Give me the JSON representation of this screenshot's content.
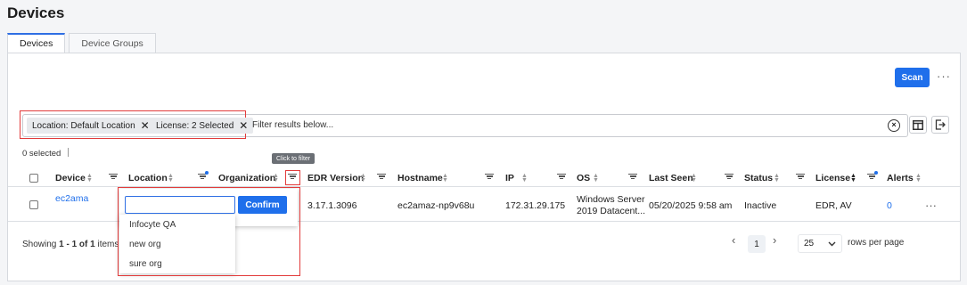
{
  "page_title": "Devices",
  "tabs": [
    {
      "label": "Devices",
      "active": true
    },
    {
      "label": "Device Groups",
      "active": false
    }
  ],
  "toolbar": {
    "scan_label": "Scan",
    "more_label": "···"
  },
  "filters": {
    "chips": [
      {
        "label": "Location:  Default Location"
      },
      {
        "label": "License:  2 Selected"
      }
    ],
    "placeholder": "Filter results below...",
    "chip_close": "✕"
  },
  "selection": {
    "text": "0 selected"
  },
  "tooltip": "Click to filter",
  "columns": [
    "Device",
    "Location",
    "Organization",
    "EDR Version",
    "Hostname",
    "IP",
    "OS",
    "Last Seen",
    "Status",
    "License",
    "Alerts"
  ],
  "rows": [
    {
      "device": "ec2ama",
      "edr_version": "3.17.1.3096",
      "hostname": "ec2amaz-np9v68u",
      "ip": "172.31.29.175",
      "os_line1": "Windows Server",
      "os_line2": "2019 Datacent...",
      "last_seen": "05/20/2025 9:58 am",
      "status": "Inactive",
      "license": "EDR, AV",
      "alerts": "0",
      "menu": "···"
    }
  ],
  "org_filter_dropdown": {
    "confirm_label": "Confirm",
    "input_value": "",
    "options": [
      "Infocyte QA",
      "new org",
      "sure org"
    ]
  },
  "footer": {
    "showing_prefix": "Showing ",
    "showing_range": "1 - 1 of 1",
    "showing_suffix": " items",
    "page_prev": "‹",
    "current_page": "1",
    "page_next": "›",
    "rows_per_page_value": "25",
    "rows_per_page_label": "rows per page"
  },
  "colors": {
    "accent": "#1f6feb",
    "highlight_box": "#e23b3b",
    "tooltip_bg": "#6b6f75"
  }
}
